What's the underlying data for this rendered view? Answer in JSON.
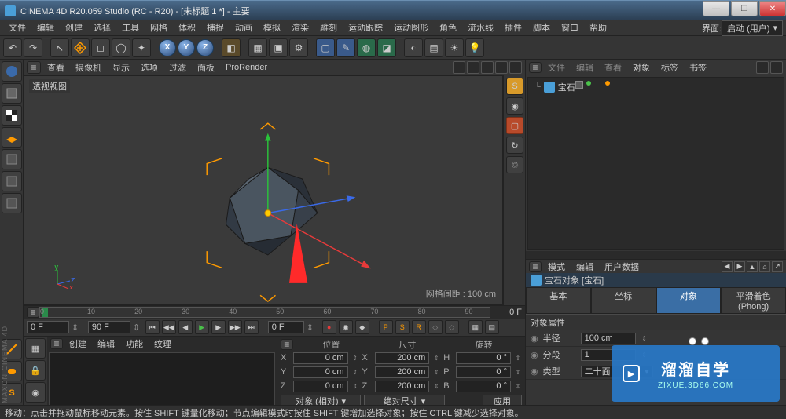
{
  "app_title": "CINEMA 4D R20.059 Studio (RC - R20) - [未标题 1 *] - 主要",
  "menu": [
    "文件",
    "编辑",
    "创建",
    "选择",
    "工具",
    "网格",
    "体积",
    "捕捉",
    "动画",
    "模拟",
    "渲染",
    "雕刻",
    "运动跟踪",
    "运动图形",
    "角色",
    "流水线",
    "插件",
    "脚本",
    "窗口",
    "帮助"
  ],
  "layout_label": "界面:",
  "layout_value": "启动 (用户)",
  "viewport": {
    "menu": [
      "查看",
      "摄像机",
      "显示",
      "选项",
      "过滤",
      "面板",
      "ProRender"
    ],
    "label": "透视视图",
    "info": "网格间距 : 100 cm"
  },
  "object_manager": {
    "tabs_text": [
      "文件",
      "编辑",
      "查看"
    ],
    "tabs_highlight": [
      "对象",
      "标签",
      "书签"
    ],
    "item_name": "宝石"
  },
  "attribute_manager": {
    "tabs": [
      "模式",
      "编辑",
      "用户数据"
    ],
    "title": "宝石对象 [宝石]",
    "prop_tabs": [
      "基本",
      "坐标",
      "对象",
      "平滑着色(Phong)"
    ],
    "section": "对象属性",
    "rows": {
      "radius_label": "半径",
      "radius_value": "100 cm",
      "segments_label": "分段",
      "segments_value": "1",
      "type_label": "类型",
      "type_value": "二十面"
    }
  },
  "timeline": {
    "ticks": [
      "0",
      "10",
      "20",
      "30",
      "40",
      "50",
      "60",
      "70",
      "80",
      "90"
    ],
    "end": "0 F",
    "start_frame": "0 F",
    "end_frame": "90 F",
    "current": "0 F"
  },
  "coords": {
    "headers": [
      "位置",
      "尺寸",
      "旋转"
    ],
    "rows": [
      {
        "axis": "X",
        "pos": "0 cm",
        "size_lbl": "X",
        "size": "200 cm",
        "rot_lbl": "H",
        "rot": "0 °"
      },
      {
        "axis": "Y",
        "pos": "0 cm",
        "size_lbl": "Y",
        "size": "200 cm",
        "rot_lbl": "P",
        "rot": "0 °"
      },
      {
        "axis": "Z",
        "pos": "0 cm",
        "size_lbl": "Z",
        "size": "200 cm",
        "rot_lbl": "B",
        "rot": "0 °"
      }
    ],
    "mode_pos": "对象 (相对)",
    "mode_size": "绝对尺寸",
    "apply": "应用"
  },
  "material_tabs": [
    "创建",
    "编辑",
    "功能",
    "纹理"
  ],
  "status": "移动：点击并拖动鼠标移动元素。按住 SHIFT 键量化移动；节点编辑模式时按住 SHIFT 键增加选择对象；按住 CTRL 键减少选择对象。",
  "watermark_brand": "溜溜自学",
  "watermark_sub": "ZIXUE.3D66.COM",
  "vertical_logo": "MAXON CINEMA 4D"
}
